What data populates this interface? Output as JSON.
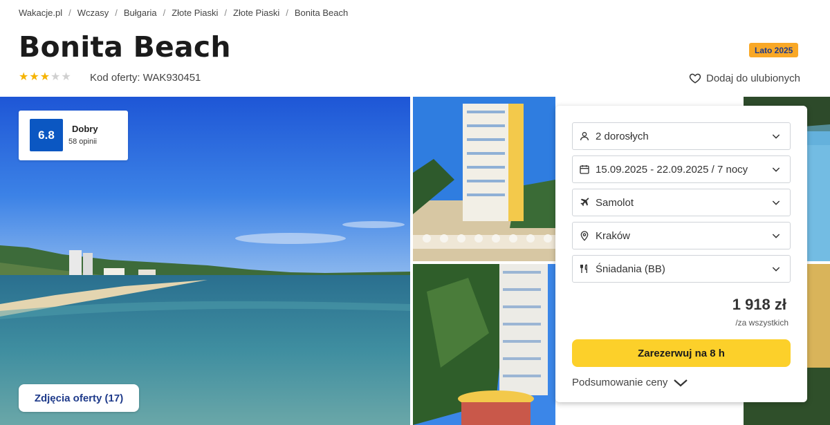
{
  "breadcrumb": [
    "Wakacje.pl",
    "Wczasy",
    "Bułgaria",
    "Złote Piaski",
    "Złote Piaski",
    "Bonita Beach"
  ],
  "breadcrumb_separator": "/",
  "hotel": {
    "title": "Bonita Beach",
    "stars": 3,
    "max_stars": 5,
    "offer_code_label": "Kod oferty:",
    "offer_code": "WAK930451",
    "season_badge": "Lato 2025",
    "favorite_label": "Dodaj do ulubionych"
  },
  "rating": {
    "score": "6.8",
    "label": "Dobry",
    "reviews": "58 opinii"
  },
  "photos_button": "Zdjęcia oferty (17)",
  "booking": {
    "travelers": "2 dorosłych",
    "dates": "15.09.2025 - 22.09.2025 / 7 nocy",
    "transport": "Samolot",
    "departure": "Kraków",
    "board": "Śniadania (BB)",
    "price": "1 918 zł",
    "price_note": "/za wszystkich",
    "book_label": "Zarezerwuj na 8 h",
    "summary_label": "Podsumowanie ceny"
  },
  "colors": {
    "badge": "#f9a826",
    "rating": "#0b57c2",
    "book_button": "#fcd02a",
    "star": "#f5b301",
    "link": "#1e3a8a"
  }
}
